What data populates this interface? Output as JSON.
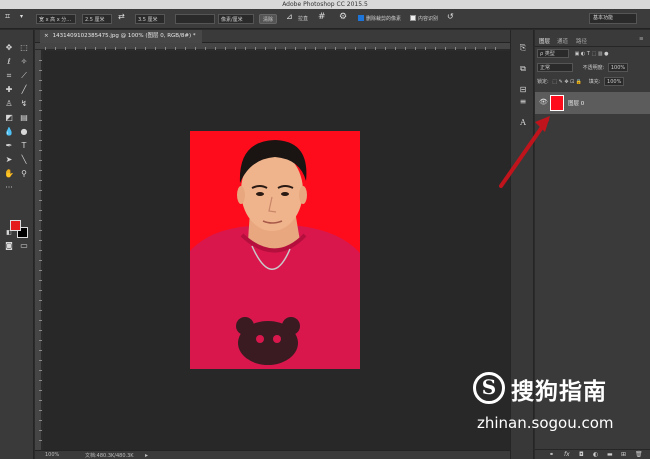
{
  "titlebar": {
    "title": "Adobe Photoshop CC 2015.5"
  },
  "options": {
    "ratio_select": "宽 x 高 x 分...",
    "width_value": "2.5 厘米",
    "swap_icon": "swap-icon",
    "height_value": "3.5 厘米",
    "resolution_value": "",
    "unit_select": "像素/厘米",
    "clear_button": "清除",
    "straighten_label": "拉直",
    "delete_cropped_label": "删除裁剪的像素",
    "delete_cropped_checked": true,
    "content_aware_label": "内容识别",
    "content_aware_checked": false,
    "workspace_select": "基本功能"
  },
  "document": {
    "tab_title": "1431409102385475.jpg @ 100% (图层 0, RGB/8#) *",
    "close_glyph": "×"
  },
  "status": {
    "zoom": "100%",
    "doc_size": "文档:480.3K/480.3K"
  },
  "layers_panel": {
    "tabs": [
      "图层",
      "通道",
      "路径"
    ],
    "active_tab": 0,
    "filter_kind": "ρ 类型",
    "blend_mode": "正常",
    "opacity_label": "不透明度:",
    "opacity_value": "100%",
    "lock_label": "锁定:",
    "fill_label": "填充:",
    "fill_value": "100%",
    "layer_name": "图层 0",
    "bottom_icons": [
      "link-icon",
      "fx-icon",
      "mask-icon",
      "adjustment-icon",
      "folder-icon",
      "new-layer-icon",
      "trash-icon"
    ]
  },
  "tools": [
    "move-icon",
    "marquee-icon",
    "lasso-icon",
    "magic-wand-icon",
    "crop-icon",
    "eyedropper-icon",
    "healing-icon",
    "brush-icon",
    "stamp-icon",
    "history-brush-icon",
    "eraser-icon",
    "gradient-icon",
    "blur-icon",
    "dodge-icon",
    "pen-icon",
    "type-icon",
    "path-select-icon",
    "line-icon",
    "hand-icon",
    "zoom-icon"
  ],
  "colors": {
    "foreground": "#e41c1c",
    "background": "#000000",
    "photo_background": "#ff0c1c",
    "arrow": "#c0141c"
  },
  "watermark": {
    "logo_letter": "S",
    "text": "搜狗指南",
    "url": "zhinan.sogou.com"
  }
}
